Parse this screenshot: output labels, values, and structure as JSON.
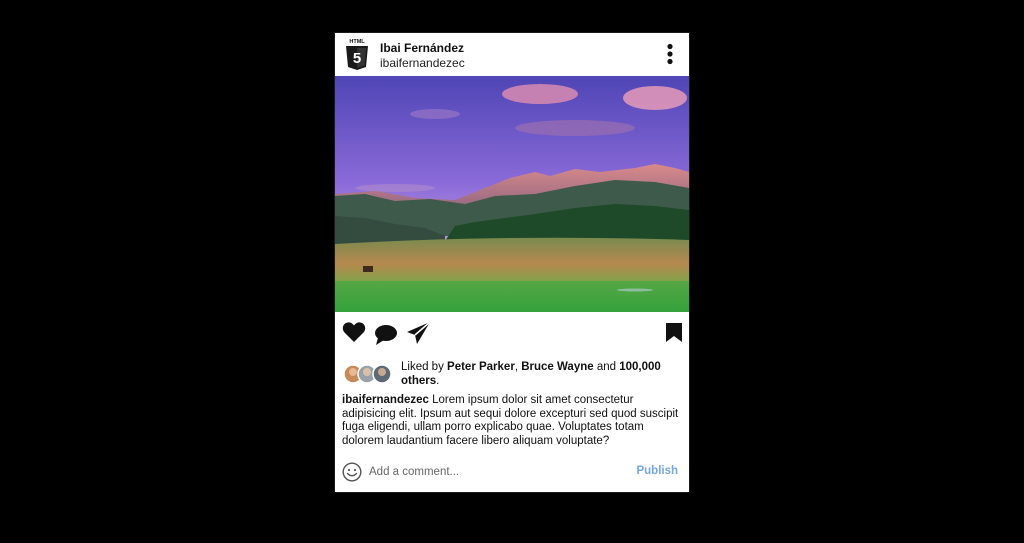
{
  "post": {
    "author_name": "Ibai Fernández",
    "author_handle": "ibaifernandezec",
    "avatar_icon": "html5-logo-icon",
    "avatar_text": "HTML",
    "avatar_digit": "5",
    "photo_description": "mountain-landscape-photo",
    "likes": {
      "prefix": "Liked by ",
      "user1": "Peter Parker",
      "separator": ", ",
      "user2": "Bruce Wayne",
      "middle": " and ",
      "others": "100,000 others",
      "suffix": "."
    },
    "caption": {
      "username": "ibaifernandezec",
      "text": " Lorem ipsum dolor sit amet consectetur adipisicing elit. Ipsum aut sequi dolore excepturi sed quod suscipit fuga eligendi, ullam porro explicabo quae. Voluptates totam dolorem laudantium facere libero aliquam voluptate?"
    }
  },
  "actions": {
    "icons": [
      "heart-icon",
      "comment-icon",
      "share-icon",
      "bookmark-icon"
    ]
  },
  "comment": {
    "placeholder": "Add a comment...",
    "publish_label": "Publish"
  },
  "colors": {
    "background": "#000000",
    "card": "#ffffff",
    "publish": "#74a7e8",
    "text": "#111111"
  }
}
